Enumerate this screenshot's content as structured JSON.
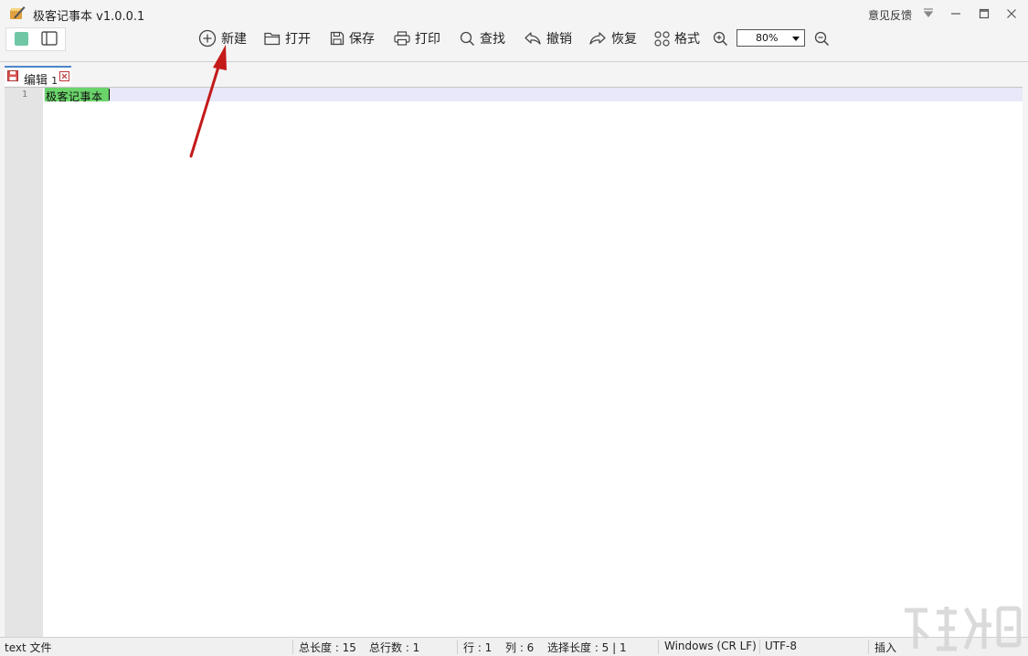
{
  "window": {
    "title": "极客记事本 v1.0.0.1",
    "feedback_label": "意见反馈"
  },
  "toolbar": {
    "items": [
      {
        "id": "new",
        "label": "新建",
        "icon": "plus-circle-icon"
      },
      {
        "id": "open",
        "label": "打开",
        "icon": "folder-icon"
      },
      {
        "id": "save",
        "label": "保存",
        "icon": "save-icon"
      },
      {
        "id": "print",
        "label": "打印",
        "icon": "printer-icon"
      },
      {
        "id": "find",
        "label": "查找",
        "icon": "search-icon"
      },
      {
        "id": "undo",
        "label": "撤销",
        "icon": "undo-icon"
      },
      {
        "id": "redo",
        "label": "恢复",
        "icon": "redo-icon"
      },
      {
        "id": "format",
        "label": "格式",
        "icon": "grid-icon"
      }
    ],
    "zoom_value": "80%"
  },
  "theme": {
    "accent": "#6fc7a6"
  },
  "tabs": [
    {
      "label": "编辑",
      "number": "1"
    }
  ],
  "editor": {
    "line_numbers": [
      "1"
    ],
    "lines": [
      "极客记事本"
    ],
    "selection_color": "#6ad36a",
    "current_line_color": "#e8e8fa"
  },
  "status": {
    "file_type": "text 文件",
    "total_length": "总长度 : 15",
    "total_lines": "总行数 : 1",
    "row": "行 : 1",
    "col": "列 : 6",
    "selection": "选择长度 : 5 | 1",
    "eol": "Windows (CR LF)",
    "encoding": "UTF-8",
    "mode": "插入"
  }
}
